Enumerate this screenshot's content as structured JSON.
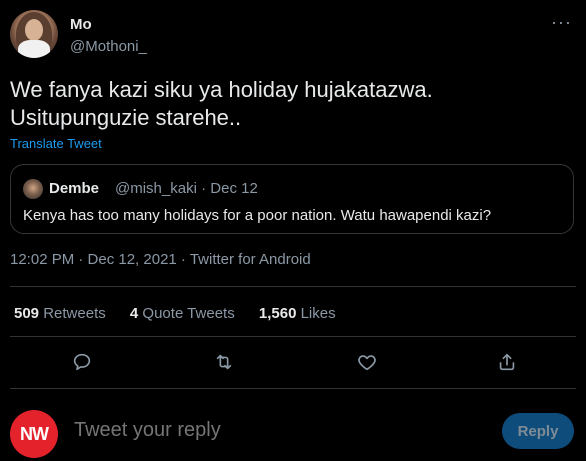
{
  "author": {
    "name": "Mo",
    "handle": "@Mothoni_"
  },
  "tweet": {
    "text": "We fanya kazi siku ya holiday hujakatazwa. Usitupunguzie starehe..",
    "translate_label": "Translate Tweet"
  },
  "quote": {
    "name": "Dembe",
    "handle": "@mish_kaki",
    "date": "Dec 12",
    "text": "Kenya has too many holidays for a poor nation. Watu hawapendi kazi?"
  },
  "meta": {
    "time": "12:02 PM",
    "date": "Dec 12, 2021",
    "source": "Twitter for Android",
    "line": "12:02 PM · Dec 12, 2021 · Twitter for Android"
  },
  "stats": {
    "retweets": "509",
    "retweets_label": "Retweets",
    "quotes": "4",
    "quotes_label": "Quote Tweets",
    "likes": "1,560",
    "likes_label": "Likes"
  },
  "actions": [
    {
      "icon": "reply-icon"
    },
    {
      "icon": "retweet-icon"
    },
    {
      "icon": "like-icon"
    },
    {
      "icon": "share-icon"
    }
  ],
  "reply": {
    "avatar_text": "NW",
    "placeholder": "Tweet your reply",
    "button_label": "Reply"
  },
  "colors": {
    "background": "#000000",
    "accent": "#1d9bf0",
    "reply_button": "#0e4d7b",
    "nw_red": "#e3222b"
  }
}
